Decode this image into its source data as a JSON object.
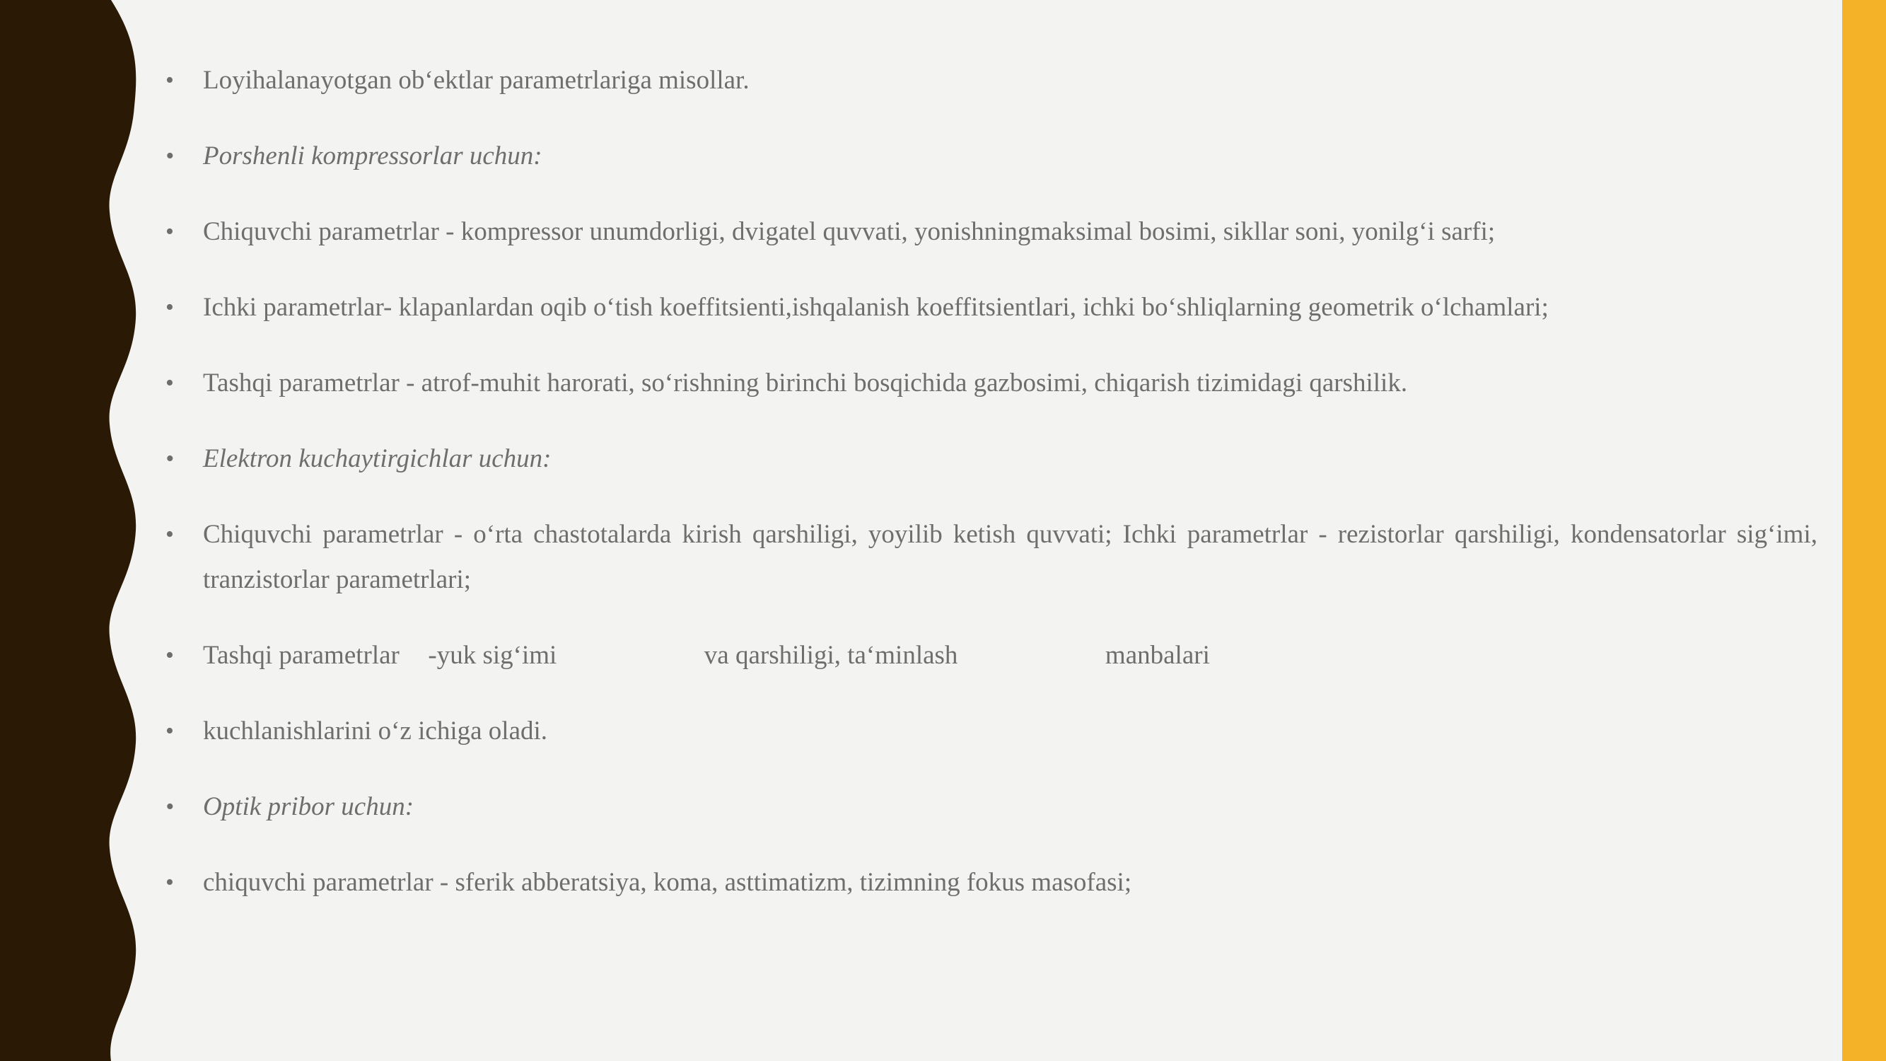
{
  "colors": {
    "background": "#f3f3f1",
    "wave": "#2a1a05",
    "accent": "#f4b229",
    "text": "#6e6e6e"
  },
  "bullets": [
    {
      "text": "Loyihalanayotgan  ob‘ektlar parametrlariga misollar.",
      "italic": false
    },
    {
      "text": "Porshenli kompressorlar uchun:",
      "italic": true
    },
    {
      "text": "Chiquvchi parametrlar - kompressor unumdorligi, dvigatel quvvati, yonishningmaksimal bosimi, sikllar soni, yonilg‘i  sarfi;",
      "italic": false
    },
    {
      "text": "Ichki parametrlar- klapanlardan oqib o‘tish koeffitsienti,ishqalanish koeffitsientlari, ichki bo‘shliqlarning geometrik o‘lchamlari;",
      "italic": false
    },
    {
      "text": "Tashqi parametrlar - atrof-muhit harorati, so‘rishning birinchi bosqichida gazbosimi, chiqarish tizimidagi qarshilik.",
      "italic": false
    },
    {
      "text": "Elektron kuchaytirgichlar uchun:",
      "italic": true
    },
    {
      "text": "Chiquvchi parametrlar - o‘rta chastotalarda kirish qarshiligi, yoyilib ketish quvvati; Ichki parametrlar - rezistorlar qarshiligi, kondensatorlar sig‘imi, tranzistorlar parametrlari;",
      "italic": false
    },
    {
      "parts": [
        "Tashqi parametrlar",
        "-yuk sig‘imi",
        "va qarshiligi, ta‘minlash",
        "manbalari"
      ],
      "italic": false
    },
    {
      "text": "kuchlanishlarini o‘z ichiga oladi.",
      "italic": false
    },
    {
      "text": "Optik pribor  uchun:",
      "italic": true
    },
    {
      "text": "chiquvchi parametrlar - sferik abberatsiya, koma, asttimatizm, tizimning fokus masofasi;",
      "italic": false
    }
  ]
}
